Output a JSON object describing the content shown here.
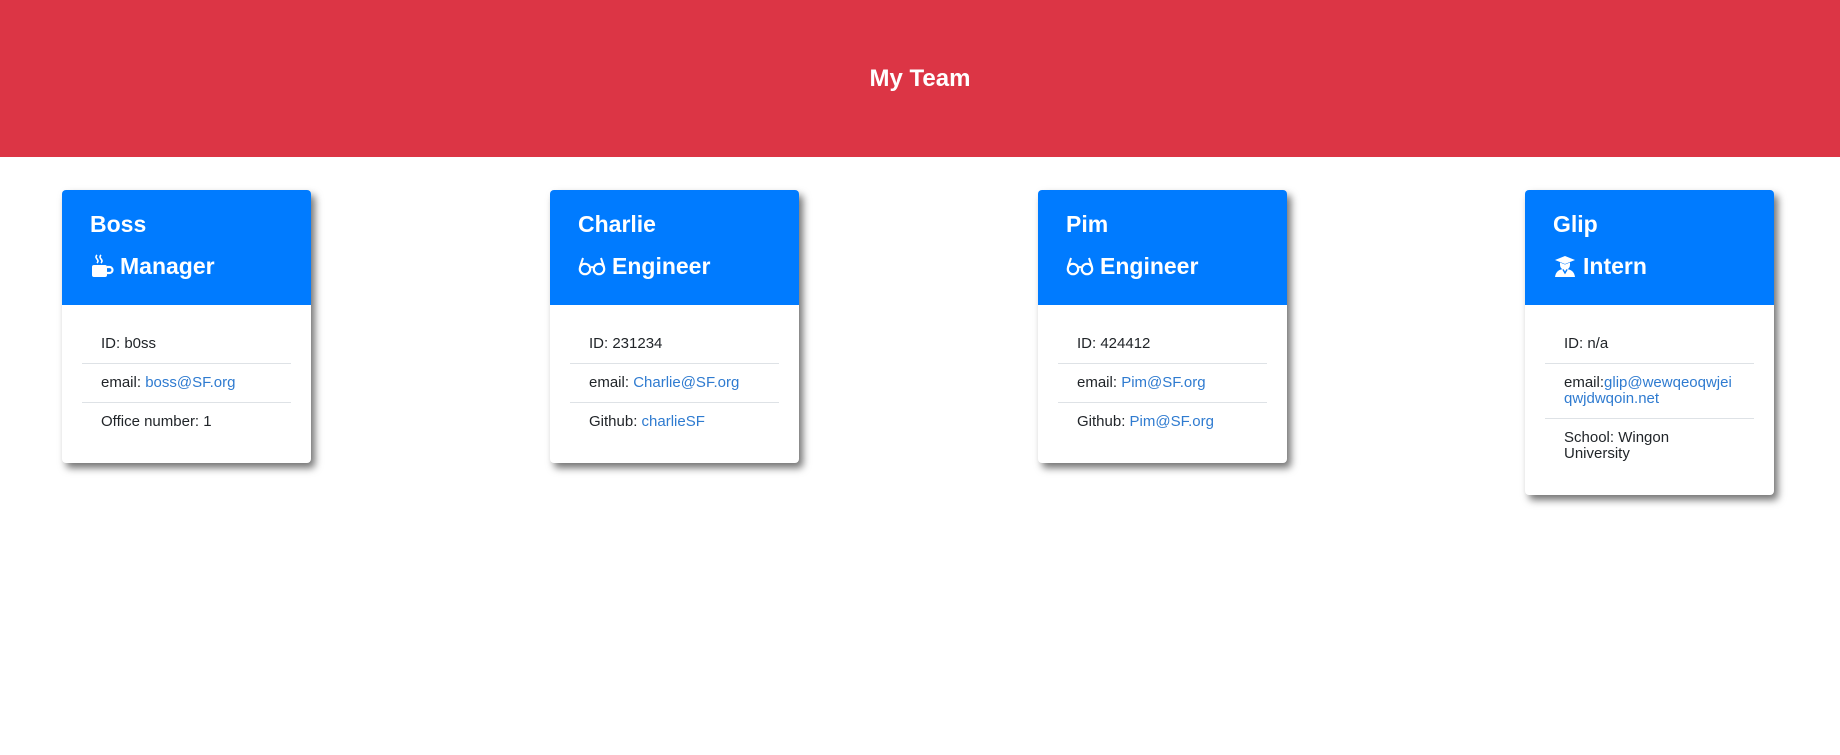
{
  "header": {
    "title": "My Team"
  },
  "colors": {
    "header_bg": "#dc3545",
    "card_header_bg": "#007bff",
    "link": "#2f7bd0"
  },
  "cards": [
    {
      "name": "Boss",
      "role": "Manager",
      "icon": "mug-icon",
      "id_label": "ID: ",
      "id_value": "b0ss",
      "email_label": "email: ",
      "email_value": "boss@SF.org",
      "extra_label": "Office number: ",
      "extra_value": "1"
    },
    {
      "name": "Charlie",
      "role": "Engineer",
      "icon": "glasses-icon",
      "id_label": "ID: ",
      "id_value": "231234",
      "email_label": "email: ",
      "email_value": "Charlie@SF.org",
      "extra_label": "Github: ",
      "extra_value": "charlieSF"
    },
    {
      "name": "Pim",
      "role": "Engineer",
      "icon": "glasses-icon",
      "id_label": "ID: ",
      "id_value": "424412",
      "email_label": "email: ",
      "email_value": "Pim@SF.org",
      "extra_label": "Github: ",
      "extra_value": "Pim@SF.org"
    },
    {
      "name": "Glip",
      "role": "Intern",
      "icon": "graduate-icon",
      "id_label": "ID: ",
      "id_value": "n/a",
      "email_label": "email:",
      "email_value": "glip@wewqeoqwjeiqwjdwqoin.net",
      "extra_label": "School: ",
      "extra_value": "Wingon University"
    }
  ]
}
